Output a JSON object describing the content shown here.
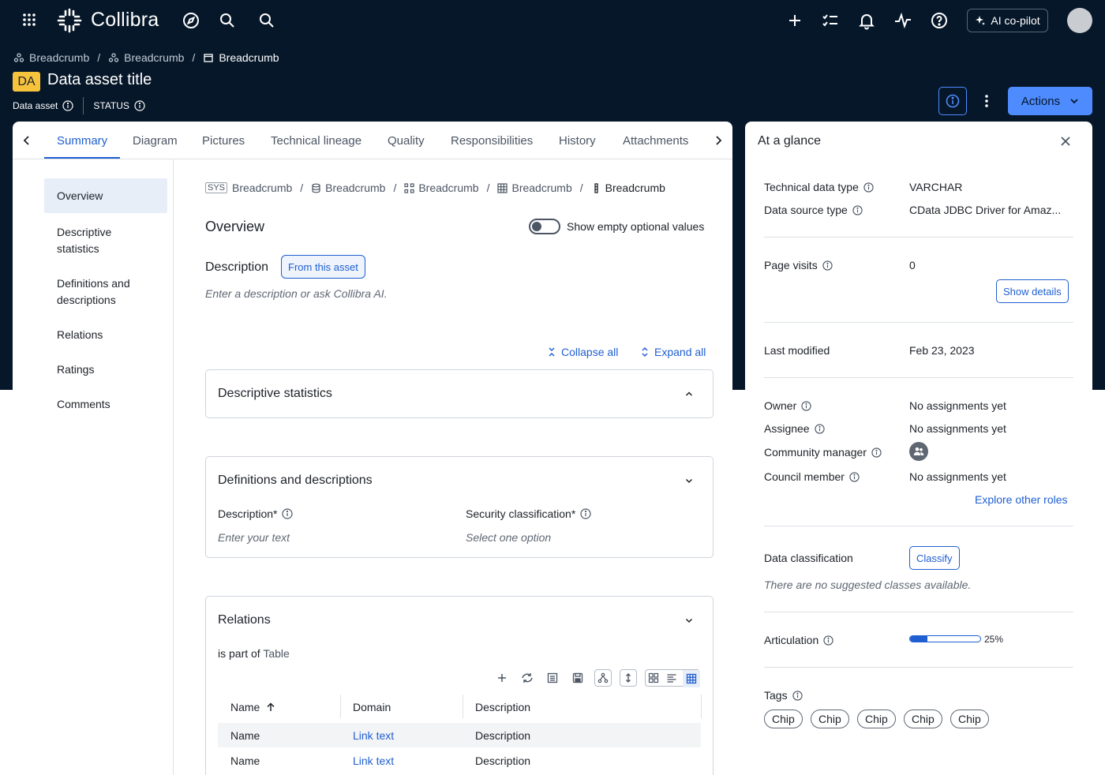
{
  "app": {
    "name": "Collibra"
  },
  "topbar": {
    "copilot_label": "AI co-pilot"
  },
  "breadcrumb": {
    "items": [
      "Breadcrumb",
      "Breadcrumb",
      "Breadcrumb"
    ]
  },
  "asset": {
    "badge": "DA",
    "title": "Data asset title",
    "type": "Data asset",
    "status": "STATUS"
  },
  "header": {
    "actions_label": "Actions"
  },
  "tabs": [
    "Summary",
    "Diagram",
    "Pictures",
    "Technical lineage",
    "Quality",
    "Responsibilities",
    "History",
    "Attachments"
  ],
  "leftnav": {
    "items": [
      "Overview",
      "Descriptive statistics",
      "Definitions and descriptions",
      "Relations",
      "Ratings",
      "Comments"
    ]
  },
  "path": {
    "sys": "SYS",
    "items": [
      "Breadcrumb",
      "Breadcrumb",
      "Breadcrumb",
      "Breadcrumb",
      "Breadcrumb"
    ]
  },
  "overview": {
    "title": "Overview",
    "toggle_label": "Show empty optional values",
    "description_label": "Description",
    "description_chip": "From this asset",
    "description_placeholder": "Enter a description or ask Collibra AI.",
    "collapse_all": "Collapse all",
    "expand_all": "Expand all"
  },
  "sections": {
    "stats": {
      "title": "Descriptive statistics"
    },
    "defs": {
      "title": "Definitions and descriptions",
      "desc_label": "Description*",
      "desc_placeholder": "Enter your text",
      "sec_label": "Security classification*",
      "sec_placeholder": "Select one option"
    },
    "relations": {
      "title": "Relations",
      "is_part_of": "is part of",
      "target": "Table",
      "columns": [
        "Name",
        "Domain",
        "Description"
      ],
      "rows": [
        {
          "name": "Name",
          "domain": "Link text",
          "description": "Description"
        },
        {
          "name": "Name",
          "domain": "Link text",
          "description": "Description"
        }
      ]
    }
  },
  "glance": {
    "title": "At a glance",
    "technical_data_type": {
      "label": "Technical data type",
      "value": "VARCHAR"
    },
    "data_source_type": {
      "label": "Data source type",
      "value": "CData JDBC Driver for Amaz..."
    },
    "page_visits": {
      "label": "Page visits",
      "value": "0",
      "button": "Show details"
    },
    "last_modified": {
      "label": "Last modified",
      "value": "Feb 23, 2023"
    },
    "owner": {
      "label": "Owner",
      "value": "No assignments yet"
    },
    "assignee": {
      "label": "Assignee",
      "value": "No assignments yet"
    },
    "community_manager": {
      "label": "Community manager"
    },
    "council_member": {
      "label": "Council member",
      "value": "No assignments yet"
    },
    "explore_roles": "Explore other roles",
    "data_classification": {
      "label": "Data classification",
      "button": "Classify",
      "note": "There are no suggested classes available."
    },
    "articulation": {
      "label": "Articulation",
      "value": 25,
      "value_text": "25%"
    },
    "tags": {
      "label": "Tags",
      "chips": [
        "Chip",
        "Chip",
        "Chip",
        "Chip",
        "Chip"
      ]
    }
  },
  "colors": {
    "navy": "#061729",
    "accent": "#4e8bff",
    "link": "#1f5fd1",
    "badge": "#f6c33c"
  }
}
